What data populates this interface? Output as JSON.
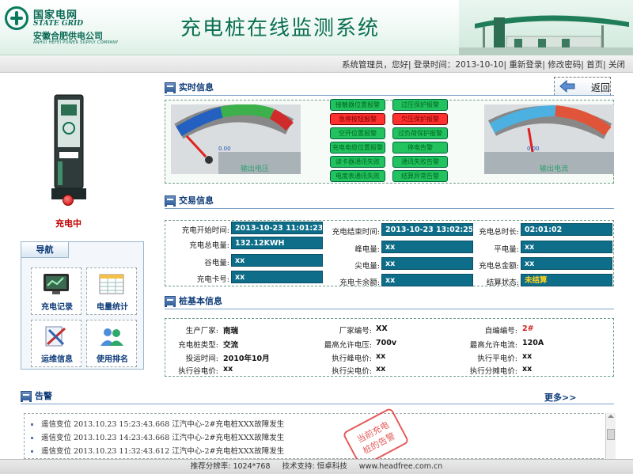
{
  "header": {
    "brand_cn": "国家电网",
    "brand_en": "STATE GRID",
    "company_cn": "安徽合肥供电公司",
    "company_en": "ANHUI HEFEI POWER SUPPLY COMPANY",
    "title": "充电桩在线监测系统"
  },
  "userbar": {
    "user": "系统管理员，您好",
    "login_label": "登录时间：",
    "login_time": "2013-10-10",
    "relogin": "重新登录",
    "change_pwd": "修改密码",
    "home": "首页",
    "close": "关闭",
    "sep": "|"
  },
  "back_label": "返回",
  "device": {
    "status": "充电中"
  },
  "nav": {
    "title": "导航",
    "items": [
      {
        "label": "充电记录",
        "icon": "chart-screen-icon"
      },
      {
        "label": "电量统计",
        "icon": "table-icon"
      },
      {
        "label": "运维信息",
        "icon": "tools-icon"
      },
      {
        "label": "使用排名",
        "icon": "users-icon"
      }
    ]
  },
  "realtime": {
    "title": "实时信息",
    "gauge_left": {
      "label": "输出电压",
      "reading": "0.00"
    },
    "gauge_right": {
      "label": "输出电流",
      "reading": "0.00"
    },
    "alarms": [
      {
        "label": "接触器位置报警",
        "state": "green"
      },
      {
        "label": "过压保护报警",
        "state": "green"
      },
      {
        "label": "急停按钮报警",
        "state": "red"
      },
      {
        "label": "欠压保护报警",
        "state": "red"
      },
      {
        "label": "空开位置报警",
        "state": "green"
      },
      {
        "label": "过负荷保护报警",
        "state": "green"
      },
      {
        "label": "充电电缆位置报警",
        "state": "green"
      },
      {
        "label": "停电告警",
        "state": "green"
      },
      {
        "label": "读卡器通讯失败",
        "state": "green"
      },
      {
        "label": "通讯失败告警",
        "state": "green"
      },
      {
        "label": "电度表通讯失败",
        "state": "green"
      },
      {
        "label": "结算异常告警",
        "state": "green"
      }
    ]
  },
  "trade": {
    "title": "交易信息",
    "start_label": "充电开始时间:",
    "start_value": "2013-10-23 11:01:23",
    "end_label": "充电结束时间:",
    "end_value": "2013-10-23 13:02:25",
    "duration_label": "充电总时长:",
    "duration_value": "02:01:02",
    "total_label": "充电总电量:",
    "total_value": "132.12KWH",
    "peak_label": "峰电量:",
    "peak_value": "xx",
    "flat_label": "平电量:",
    "flat_value": "xx",
    "valley_label": "谷电量:",
    "valley_value": "xx",
    "sharp_label": "尖电量:",
    "sharp_value": "xx",
    "amount_label": "充电总金额:",
    "amount_value": "xx",
    "card_label": "充电卡号:",
    "card_value": "xx",
    "balance_label": "充电卡余额:",
    "balance_value": "xx",
    "settle_label": "结算状态:",
    "settle_value": "未结算"
  },
  "base": {
    "title": "桩基本信息",
    "maker_label": "生产厂家:",
    "maker_value": "南瑞",
    "factory_no_label": "厂家编号:",
    "factory_no_value": "XX",
    "self_no_label": "自编编号:",
    "self_no_value": "2#",
    "type_label": "充电桩类型:",
    "type_value": "交流",
    "max_v_label": "最高允许电压:",
    "max_v_value": "700v",
    "max_i_label": "最高允许电流:",
    "max_i_value": "120A",
    "date_label": "投运时间:",
    "date_value": "2010年10月",
    "peak_price_label": "执行峰电价:",
    "peak_price_value": "xx",
    "flat_price_label": "执行平电价:",
    "flat_price_value": "xx",
    "valley_price_label": "执行谷电价:",
    "valley_price_value": "xx",
    "sharp_price_label": "执行尖电价:",
    "sharp_price_value": "xx",
    "share_price_label": "执行分摊电价:",
    "share_price_value": "xx"
  },
  "alarm_list": {
    "title": "告警",
    "more": "更多>>",
    "rows": [
      "遥信变位 2013.10.23 15:23:43.668 江汽中心-2#充电桩XXX故障发生",
      "遥信变位 2013.10.23 14:23:43.668 江汽中心-2#充电桩XXX故障发生",
      "遥信变位 2013.10.23 11:32:43.612 江汽中心-2#充电桩XXX故障发生"
    ],
    "stamp_line1": "当前充电",
    "stamp_line2": "桩的告警"
  },
  "footer": {
    "resolution": "推荐分辨率: 1024*768",
    "support": "技术支持: 恒卓科技",
    "url": "www.headfree.com.cn"
  },
  "colors": {
    "brand_green": "#0b6f52",
    "value_bg": "#0e6e8a",
    "alarm_green": "#22c25e",
    "alarm_red": "#ff3030",
    "section_blue": "#0c3a78"
  }
}
